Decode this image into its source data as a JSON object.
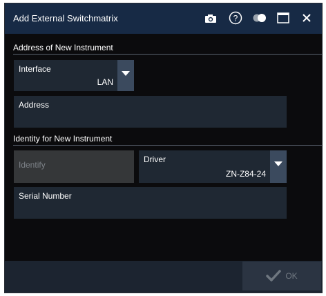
{
  "window": {
    "title": "Add External Switchmatrix",
    "icons": [
      "camera-icon",
      "help-icon",
      "toggle-icon",
      "maximize-icon",
      "close-icon"
    ]
  },
  "address_section": {
    "header": "Address of New Instrument",
    "interface": {
      "label": "Interface",
      "value": "LAN"
    },
    "address": {
      "label": "Address",
      "value": ""
    }
  },
  "identity_section": {
    "header": "Identity for New Instrument",
    "identify_button": "Identify",
    "driver": {
      "label": "Driver",
      "value": "ZN-Z84-24"
    },
    "serial": {
      "label": "Serial Number",
      "value": ""
    }
  },
  "footer": {
    "ok_label": "OK"
  },
  "colors": {
    "titlebar": "#172a45",
    "field": "#1f2833",
    "dropdown": "#3b4a5e",
    "background": "#0b0b0d"
  }
}
